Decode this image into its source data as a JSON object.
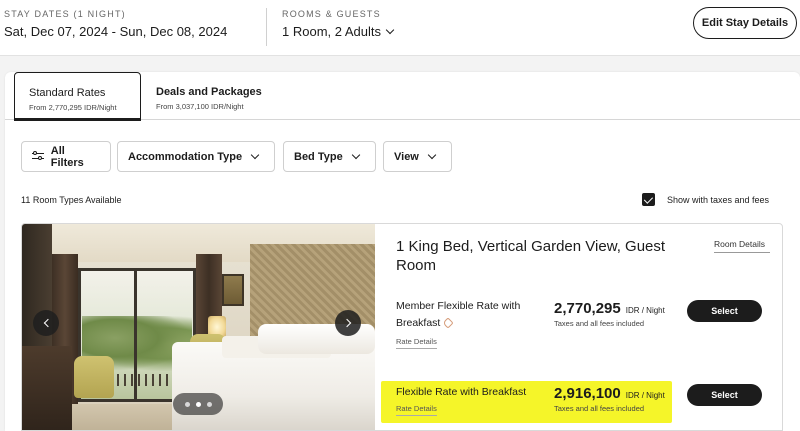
{
  "header": {
    "stay_label": "STAY DATES (1 NIGHT)",
    "stay_value": "Sat, Dec 07, 2024 - Sun, Dec 08, 2024",
    "rooms_label": "ROOMS & GUESTS",
    "rooms_value": "1 Room, 2 Adults",
    "edit_button": "Edit Stay Details"
  },
  "tabs": [
    {
      "title": "Standard Rates",
      "subtitle": "From 2,770,295 IDR/Night",
      "active": true
    },
    {
      "title": "Deals and Packages",
      "subtitle": "From 3,037,100 IDR/Night",
      "active": false
    }
  ],
  "filters": {
    "all_filters": "All Filters",
    "accommodation_type": "Accommodation Type",
    "bed_type": "Bed Type",
    "view": "View"
  },
  "results": {
    "count_text": "11 Room Types Available",
    "taxes_toggle_label": "Show with taxes and fees",
    "taxes_toggle_checked": true
  },
  "room": {
    "title": "1 King Bed, Vertical Garden View, Guest Room",
    "details_link": "Room Details",
    "photo_count": 3,
    "active_photo": 1,
    "rates": [
      {
        "name_line1": "Member Flexible Rate with",
        "name_line2": "Breakfast",
        "details_link": "Rate Details",
        "price": "2,770,295",
        "unit": "IDR / Night",
        "note": "Taxes and all fees included",
        "select": "Select",
        "highlighted": false
      },
      {
        "name_line1": "Flexible Rate with Breakfast",
        "details_link": "Rate Details",
        "price": "2,916,100",
        "unit": "IDR / Night",
        "note": "Taxes and all fees included",
        "select": "Select",
        "highlighted": true
      }
    ]
  },
  "colors": {
    "primary": "#1c1c1c",
    "highlight": "#f5f529",
    "background": "#f3f3f3",
    "member_tag": "#d59c7a"
  },
  "icons": {
    "filters": "sliders-icon",
    "chevron": "chevron-down-icon",
    "checkbox": "checkmark-icon",
    "member": "tag-icon",
    "carousel_prev": "chevron-left-icon",
    "carousel_next": "chevron-right-icon"
  }
}
